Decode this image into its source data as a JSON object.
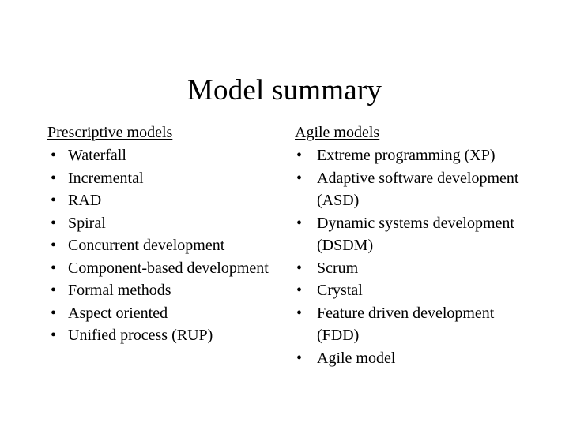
{
  "slide": {
    "title": "Model summary",
    "background_color": "#ffffff",
    "text_color": "#000000",
    "bullet_glyph": "•"
  },
  "columns": [
    {
      "id": "prescriptive",
      "heading": "Prescriptive models",
      "items": [
        "Waterfall",
        "Incremental",
        "RAD",
        "Spiral",
        "Concurrent development",
        "Component-based development",
        "Formal methods",
        "Aspect oriented",
        "Unified process (RUP)"
      ]
    },
    {
      "id": "agile",
      "heading": "Agile models",
      "items": [
        "Extreme programming (XP)",
        "Adaptive software development (ASD)",
        "Dynamic systems development (DSDM)",
        "Scrum",
        "Crystal",
        "Feature driven development (FDD)",
        "Agile model"
      ]
    }
  ]
}
